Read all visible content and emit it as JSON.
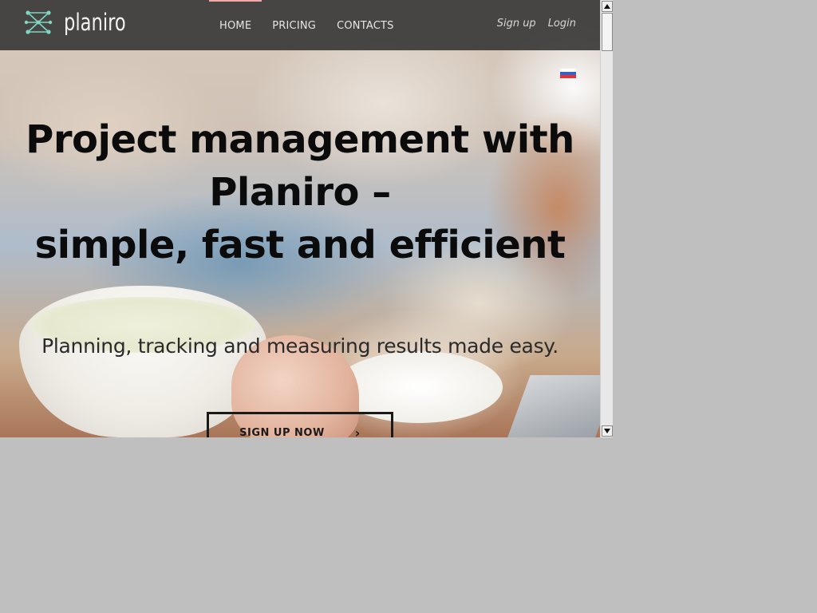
{
  "nav": {
    "logo_text": "planiro",
    "links": [
      {
        "label": "HOME",
        "active": true
      },
      {
        "label": "PRICING",
        "active": false
      },
      {
        "label": "CONTACTS",
        "active": false
      }
    ],
    "active_indicator_color": "#f0a8a8",
    "signup_label": "Sign up",
    "login_label": "Login"
  },
  "language": {
    "flag_icon": "russian-flag-icon",
    "flag_colors": [
      "#ffffff",
      "#3b5fc6",
      "#e0333b"
    ]
  },
  "hero": {
    "title_lines": [
      "Project management with",
      "Planiro –",
      "simple, fast and efficient"
    ],
    "subtitle": "Planning, tracking and measuring results made easy.",
    "cta_label": "SIGN UP NOW",
    "cta_icon": "chevron-right-icon"
  },
  "colors": {
    "navbar_bg": "#323232",
    "logo_accent": "#7fd6c2",
    "title_text": "#0b0b0b"
  },
  "scrollbar": {
    "up_icon": "arrow-up-icon",
    "down_icon": "arrow-down-icon"
  }
}
